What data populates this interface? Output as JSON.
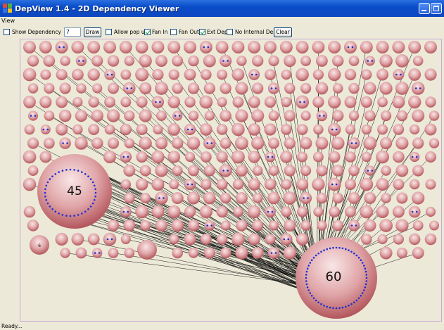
{
  "window": {
    "title": "DepView 1.4 - 2D Dependency Viewer",
    "app_icon": "app-icon",
    "controls": [
      "minimize-icon",
      "maximize-icon"
    ]
  },
  "menu": {
    "items": [
      "View"
    ]
  },
  "toolbar": {
    "show_dependency": {
      "label": "Show Dependency",
      "checked": false
    },
    "dependency_value": "7",
    "draw_label": "Draw",
    "allow_popup": {
      "label": "Allow pop up",
      "checked": false
    },
    "fan_in": {
      "label": "Fan In",
      "checked": true
    },
    "fan_out": {
      "label": "Fan Out",
      "checked": false
    },
    "ext_dep": {
      "label": "Ext Dep",
      "checked": true
    },
    "no_internal_dep": {
      "label": "No Internal Dep",
      "checked": false
    },
    "clear_label": "Clear"
  },
  "graph": {
    "node_labels": [
      "45",
      "60",
      "6"
    ],
    "colors": {
      "node_light": "#f7e1e1",
      "node_dark": "#b3565c",
      "edge": "#000000",
      "port": "#1b2fd6",
      "frame": "#c9a8d8",
      "background": "#ece9d8"
    }
  },
  "status": "Ready..."
}
